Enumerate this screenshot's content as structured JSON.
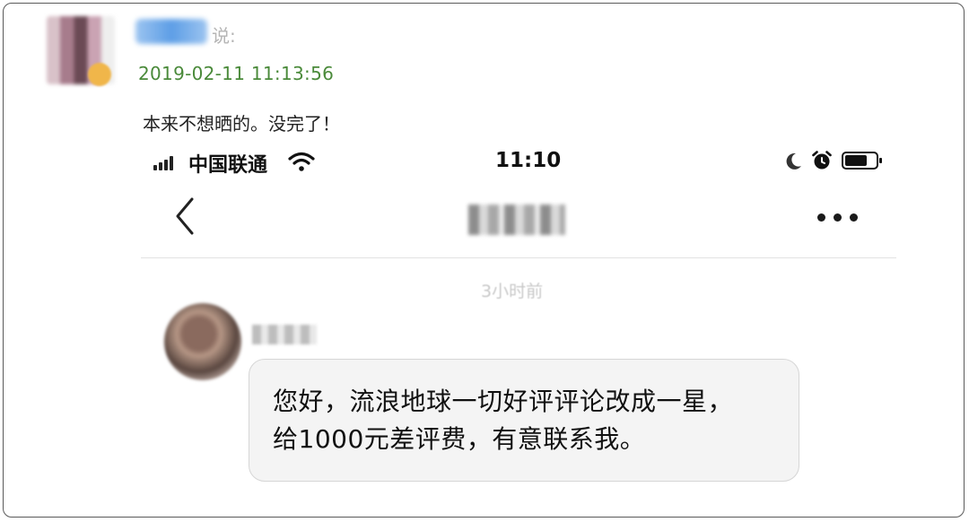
{
  "post": {
    "author_suffix": "说:",
    "timestamp": "2019-02-11 11:13:56",
    "text": "本来不想晒的。没完了！"
  },
  "status_bar": {
    "carrier": "中国联通",
    "time": "11:10",
    "icons": [
      "signal-icon",
      "wifi-icon",
      "moon-icon",
      "alarm-icon",
      "battery-icon"
    ]
  },
  "nav": {
    "back_icon": "chevron-left-icon",
    "more_icon": "ellipsis-icon"
  },
  "chat": {
    "time_label": "3小时前",
    "message_lines": [
      "您好，流浪地球一切好评评论改成一星，",
      "给1000元差评费，有意联系我。"
    ]
  },
  "colors": {
    "timestamp_green": "#4a8a3a",
    "bubble_bg": "#f4f4f4",
    "divider": "#e2e2e2"
  }
}
